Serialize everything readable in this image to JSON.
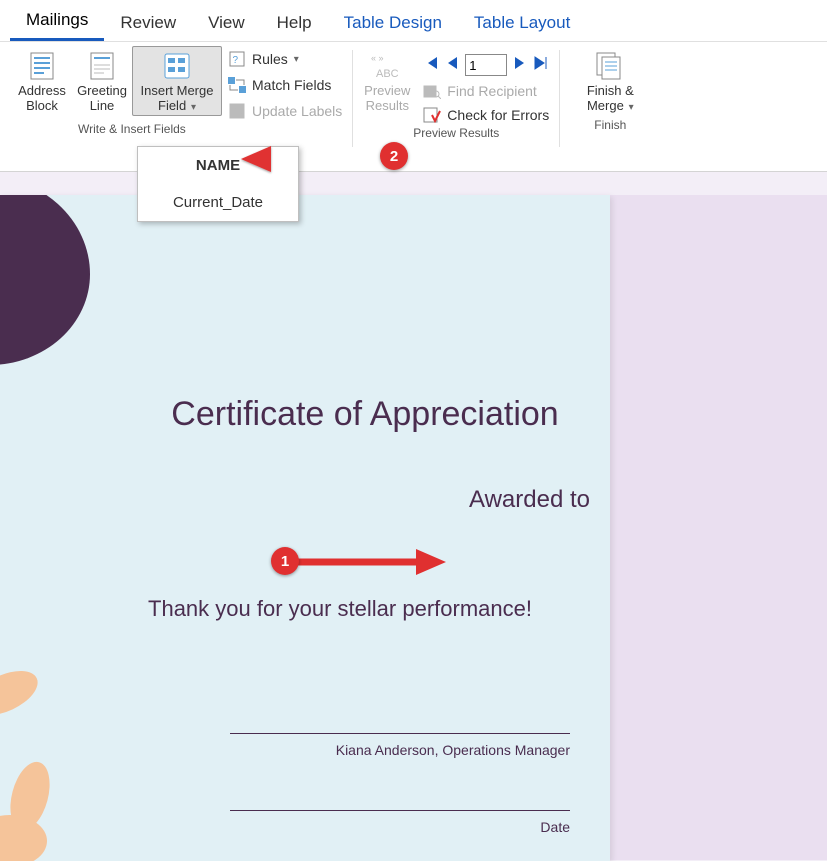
{
  "tabs": {
    "items": [
      "Mailings",
      "Review",
      "View",
      "Help",
      "Table Design",
      "Table Layout"
    ],
    "active": "Mailings"
  },
  "ribbon": {
    "addressBlock": "Address Block",
    "greetingLine": "Greeting Line",
    "insertMergeField": "Insert Merge Field",
    "rules": "Rules",
    "matchFields": "Match Fields",
    "updateLabels": "Update Labels",
    "previewResults": "Preview Results",
    "findRecipient": "Find Recipient",
    "checkErrors": "Check for Errors",
    "finishMerge": "Finish & Merge",
    "recordValue": "1"
  },
  "groupLabels": {
    "writeInsert": "Write & Insert Fields",
    "previewResults": "Preview Results",
    "finish": "Finish"
  },
  "dropdown": {
    "items": [
      "NAME",
      "Current_Date"
    ]
  },
  "document": {
    "title": "Certificate of Appreciation",
    "awardedTo": "Awarded to",
    "thanks": "Thank you for your stellar performance!",
    "signer": "Kiana Anderson, Operations Manager",
    "dateLabel": "Date"
  },
  "annotations": {
    "badge1": "1",
    "badge2": "2"
  }
}
